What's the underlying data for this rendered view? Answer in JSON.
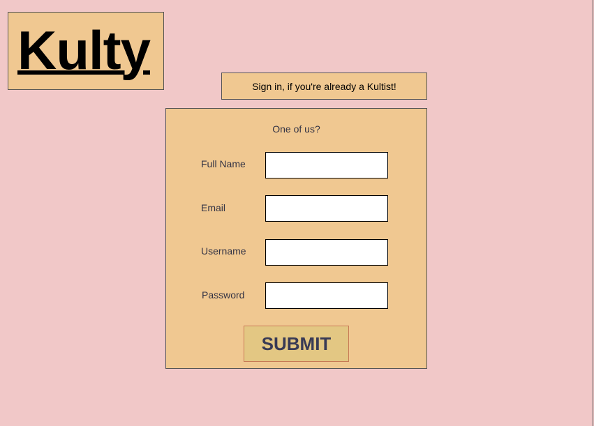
{
  "header": {
    "logo_text": "Kulty"
  },
  "signin": {
    "label": "Sign in, if you're already a Kultist!"
  },
  "signup_form": {
    "title": "One of us?",
    "fields": [
      {
        "label": "Full Name",
        "value": ""
      },
      {
        "label": "Email",
        "value": ""
      },
      {
        "label": "Username",
        "value": ""
      },
      {
        "label": "Password",
        "value": ""
      }
    ],
    "submit_label": "SUBMIT"
  },
  "colors": {
    "page_background": "#f1c8c8",
    "panel_background": "#f0c891",
    "submit_background": "#e3c783",
    "submit_text": "#383a55"
  }
}
